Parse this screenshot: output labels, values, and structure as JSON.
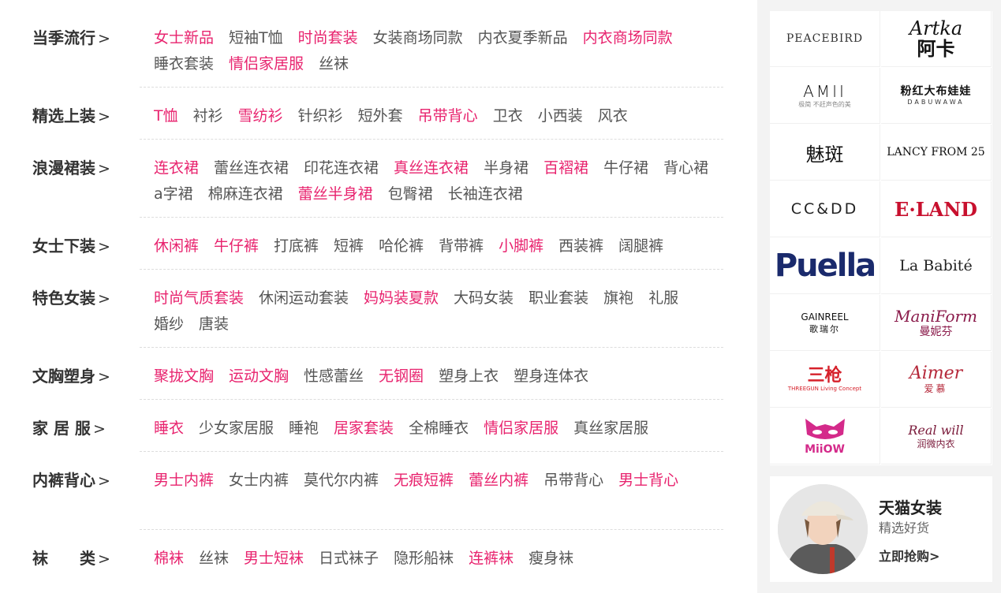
{
  "categories": [
    {
      "title": "当季流行",
      "links": [
        {
          "text": "女士新品",
          "hot": true
        },
        {
          "text": "短袖T恤",
          "hot": false
        },
        {
          "text": "时尚套装",
          "hot": true
        },
        {
          "text": "女装商场同款",
          "hot": false
        },
        {
          "text": "内衣夏季新品",
          "hot": false
        },
        {
          "text": "内衣商场同款",
          "hot": true
        },
        {
          "text": "睡衣套装",
          "hot": false
        },
        {
          "text": "情侣家居服",
          "hot": true
        },
        {
          "text": "丝袜",
          "hot": false
        }
      ]
    },
    {
      "title": "精选上装",
      "links": [
        {
          "text": "T恤",
          "hot": true
        },
        {
          "text": "衬衫",
          "hot": false
        },
        {
          "text": "雪纺衫",
          "hot": true
        },
        {
          "text": "针织衫",
          "hot": false
        },
        {
          "text": "短外套",
          "hot": false
        },
        {
          "text": "吊带背心",
          "hot": true
        },
        {
          "text": "卫衣",
          "hot": false
        },
        {
          "text": "小西装",
          "hot": false
        },
        {
          "text": "风衣",
          "hot": false
        }
      ]
    },
    {
      "title": "浪漫裙装",
      "links": [
        {
          "text": "连衣裙",
          "hot": true
        },
        {
          "text": "蕾丝连衣裙",
          "hot": false
        },
        {
          "text": "印花连衣裙",
          "hot": false
        },
        {
          "text": "真丝连衣裙",
          "hot": true
        },
        {
          "text": "半身裙",
          "hot": false
        },
        {
          "text": "百褶裙",
          "hot": true
        },
        {
          "text": "牛仔裙",
          "hot": false
        },
        {
          "text": "背心裙",
          "hot": false
        },
        {
          "text": "a字裙",
          "hot": false
        },
        {
          "text": "棉麻连衣裙",
          "hot": false
        },
        {
          "text": "蕾丝半身裙",
          "hot": true
        },
        {
          "text": "包臀裙",
          "hot": false
        },
        {
          "text": "长袖连衣裙",
          "hot": false
        }
      ]
    },
    {
      "title": "女士下装",
      "links": [
        {
          "text": "休闲裤",
          "hot": true
        },
        {
          "text": "牛仔裤",
          "hot": true
        },
        {
          "text": "打底裤",
          "hot": false
        },
        {
          "text": "短裤",
          "hot": false
        },
        {
          "text": "哈伦裤",
          "hot": false
        },
        {
          "text": "背带裤",
          "hot": false
        },
        {
          "text": "小脚裤",
          "hot": true
        },
        {
          "text": "西装裤",
          "hot": false
        },
        {
          "text": "阔腿裤",
          "hot": false
        }
      ]
    },
    {
      "title": "特色女装",
      "links": [
        {
          "text": "时尚气质套装",
          "hot": true
        },
        {
          "text": "休闲运动套装",
          "hot": false
        },
        {
          "text": "妈妈装夏款",
          "hot": true
        },
        {
          "text": "大码女装",
          "hot": false
        },
        {
          "text": "职业套装",
          "hot": false
        },
        {
          "text": "旗袍",
          "hot": false
        },
        {
          "text": "礼服",
          "hot": false
        },
        {
          "text": "婚纱",
          "hot": false
        },
        {
          "text": "唐装",
          "hot": false
        }
      ]
    },
    {
      "title": "文胸塑身",
      "links": [
        {
          "text": "聚拢文胸",
          "hot": true
        },
        {
          "text": "运动文胸",
          "hot": true
        },
        {
          "text": "性感蕾丝",
          "hot": false
        },
        {
          "text": "无钢圈",
          "hot": true
        },
        {
          "text": "塑身上衣",
          "hot": false
        },
        {
          "text": "塑身连体衣",
          "hot": false
        }
      ]
    },
    {
      "title": "家 居 服",
      "links": [
        {
          "text": "睡衣",
          "hot": true
        },
        {
          "text": "少女家居服",
          "hot": false
        },
        {
          "text": "睡袍",
          "hot": false
        },
        {
          "text": "居家套装",
          "hot": true
        },
        {
          "text": "全棉睡衣",
          "hot": false
        },
        {
          "text": "情侣家居服",
          "hot": true
        },
        {
          "text": "真丝家居服",
          "hot": false
        }
      ]
    },
    {
      "title": "内裤背心",
      "links": [
        {
          "text": "男士内裤",
          "hot": true
        },
        {
          "text": "女士内裤",
          "hot": false
        },
        {
          "text": "莫代尔内裤",
          "hot": false
        },
        {
          "text": "无痕短裤",
          "hot": true
        },
        {
          "text": "蕾丝内裤",
          "hot": true
        },
        {
          "text": "吊带背心",
          "hot": false
        },
        {
          "text": "男士背心",
          "hot": true
        }
      ]
    },
    {
      "title": "袜　　类",
      "links": [
        {
          "text": "棉袜",
          "hot": true
        },
        {
          "text": "丝袜",
          "hot": false
        },
        {
          "text": "男士短袜",
          "hot": true
        },
        {
          "text": "日式袜子",
          "hot": false
        },
        {
          "text": "隐形船袜",
          "hot": false
        },
        {
          "text": "连裤袜",
          "hot": true
        },
        {
          "text": "瘦身袜",
          "hot": false
        }
      ]
    }
  ],
  "chevron": ">",
  "brands": {
    "peacebird": "PEACEBIRD",
    "artka_en": "Artka",
    "artka_cn": "阿卡",
    "amii_en": "AMII",
    "amii_sub": "极简 不赶声色的美",
    "dabu_cn": "粉红大布娃娃",
    "dabu_en": "DABUWAWA",
    "meiban": "魅斑",
    "lancy": "LANCY FROM 25",
    "ccdd": "CC&DD",
    "eland": "E·LAND",
    "puella": "Puella",
    "labetite": "La Babité",
    "gain_en": "GAINREEL",
    "gain_cn": "歌瑞尔",
    "manif_en": "ManiForm",
    "manif_cn": "曼妮芬",
    "sanqiang_cn": "三枪",
    "sanqiang_en": "THREEGUN Living Concept",
    "aimer_en": "Aimer",
    "aimer_cn": "爱慕",
    "miiow": "MiiOW",
    "realwill_en": "Real will",
    "realwill_cn": "润微内衣"
  },
  "promo": {
    "title": "天猫女装",
    "subtitle": "精选好货",
    "cta": "立即抢购>"
  },
  "colors": {
    "hot_link": "#e8236e",
    "normal_link": "#555555",
    "title": "#333333"
  }
}
